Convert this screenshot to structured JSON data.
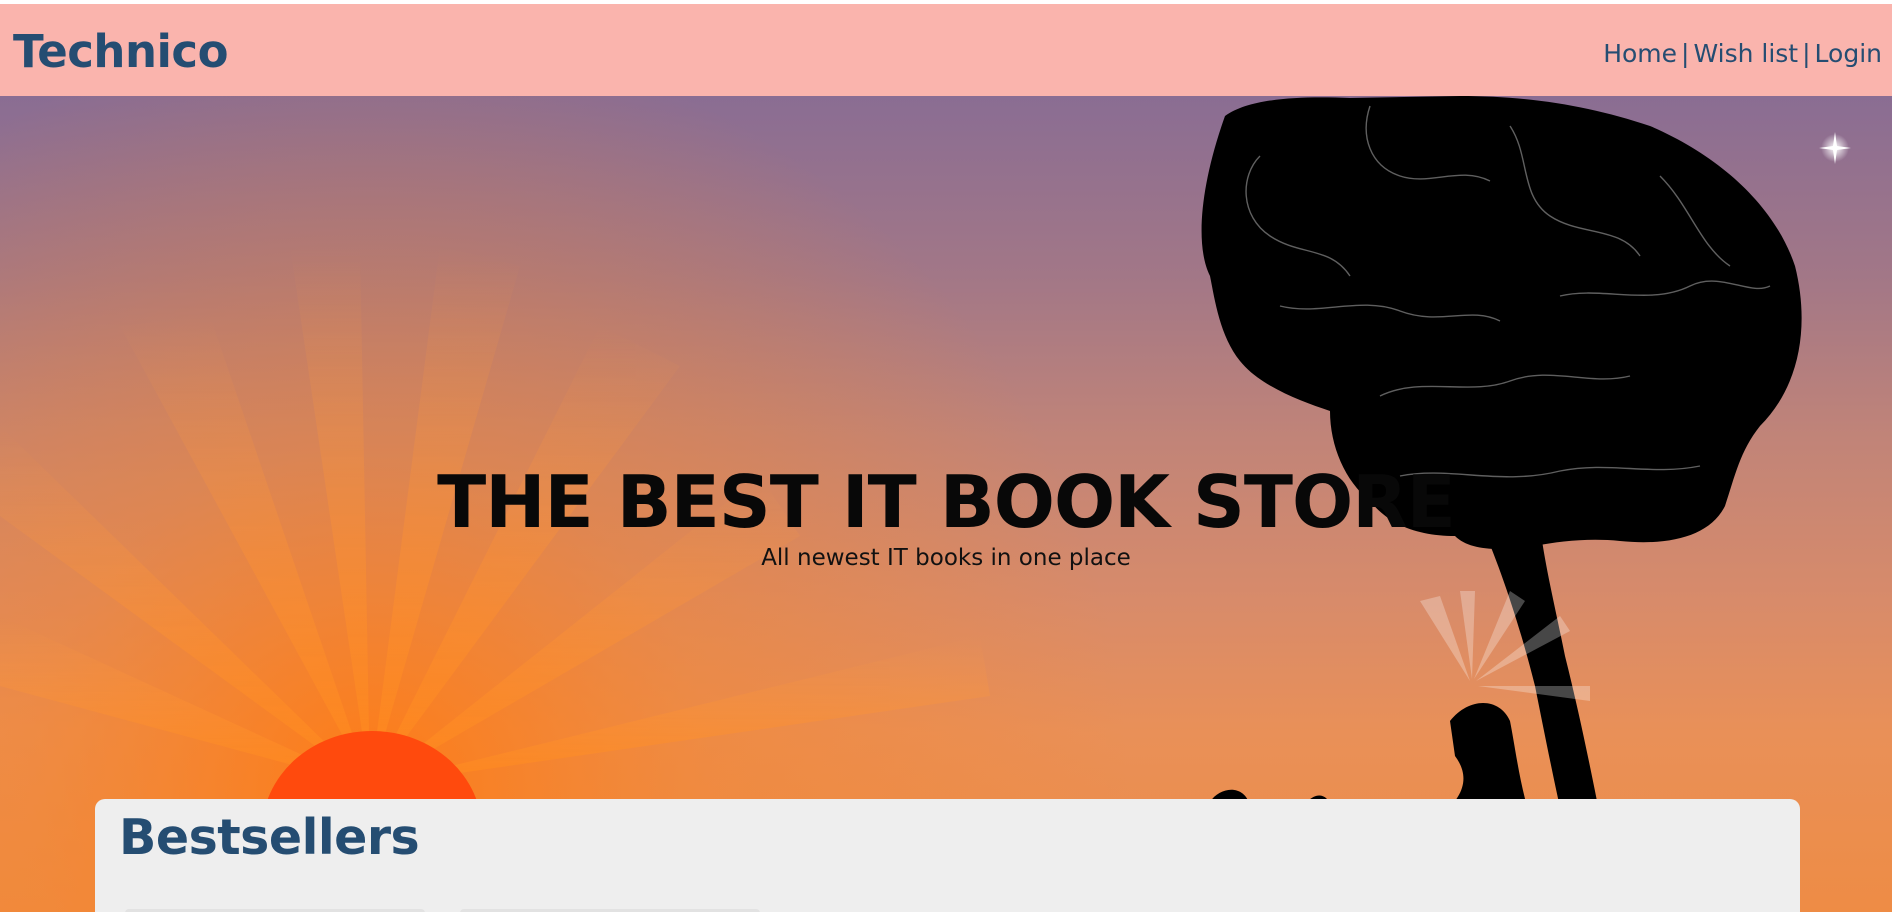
{
  "navbar": {
    "brand": "Technico",
    "links": {
      "home": "Home",
      "wishlist": "Wish list",
      "login": "Login",
      "separator": "|"
    }
  },
  "hero": {
    "title": "THE BEST IT BOOK STORE",
    "subtitle": "All newest IT books in one place",
    "illustration": "brain-tree-reader-sunset"
  },
  "bestsellers": {
    "title": "Bestsellers"
  },
  "colors": {
    "navbar_background": "#fab4ad",
    "brand_text": "#254d72",
    "hero_sky_top": "#8a6d93",
    "hero_sky_bottom": "#ee8c45",
    "sun": "#ff4a0d",
    "silhouette": "#000000",
    "panel_background": "#eeeeee"
  }
}
